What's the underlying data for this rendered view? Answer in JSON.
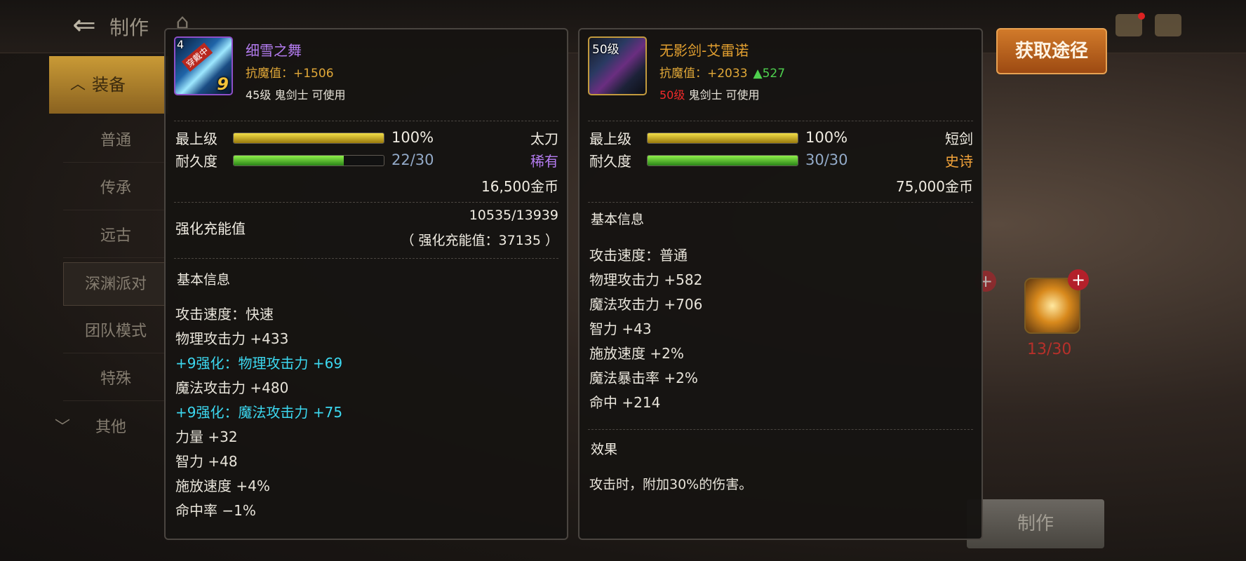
{
  "header": {
    "title": "制作"
  },
  "sidebar": {
    "category_open": "装备",
    "items": [
      "普通",
      "传承",
      "远古",
      "深渊派对",
      "团队模式",
      "特殊"
    ],
    "category_closed": "其他"
  },
  "obtain_button": "获取途径",
  "craft_button": "制作",
  "slot_count": "13/30",
  "colors": {
    "rarity_rare": "#b47cf0",
    "rarity_epic": "#f2a33a",
    "enhance_stat": "#3cd8f0",
    "resist_gold": "#e1a838",
    "required_level_red": "#f02a2a"
  },
  "left_item": {
    "icon_level": "4",
    "icon_badge": "穿戴中",
    "enhance_level": "9",
    "name": "细雪之舞",
    "resist": "抗魔值：+1506",
    "requirement": "45级 鬼剑士 可使用",
    "max_level_label": "最上级",
    "max_level_value": "100%",
    "max_level_fraction": 1.0,
    "weapon_type": "太刀",
    "durability_label": "耐久度",
    "durability_value": "22/30",
    "durability_fraction": 0.733,
    "rarity": "稀有",
    "price": "16,500金币",
    "charge_label": "强化充能值",
    "charge_current": "10535/13939",
    "charge_total": "（ 强化充能值：37135 ）",
    "basic_info_title": "基本信息",
    "stats": [
      "攻击速度：快速",
      "物理攻击力 +433",
      "+9强化：物理攻击力 +69",
      "魔法攻击力 +480",
      "+9强化：魔法攻击力 +75",
      "力量 +32",
      "智力 +48",
      "施放速度 +4%",
      "命中率 −1%"
    ]
  },
  "right_item": {
    "icon_level": "50级",
    "name": "无影剑-艾雷诺",
    "resist": "抗魔值：+2033",
    "resist_diff": "▲527",
    "required_level": "50级",
    "requirement_rest": " 鬼剑士 可使用",
    "max_level_label": "最上级",
    "max_level_value": "100%",
    "max_level_fraction": 1.0,
    "weapon_type": "短剑",
    "durability_label": "耐久度",
    "durability_value": "30/30",
    "durability_fraction": 1.0,
    "rarity": "史诗",
    "price": "75,000金币",
    "basic_info_title": "基本信息",
    "stats": [
      "攻击速度：普通",
      "物理攻击力 +582",
      "魔法攻击力 +706",
      "智力 +43",
      "施放速度 +2%",
      "魔法暴击率 +2%",
      "命中 +214"
    ],
    "effect_title": "效果",
    "effect_text": "攻击时，附加30%的伤害。"
  }
}
